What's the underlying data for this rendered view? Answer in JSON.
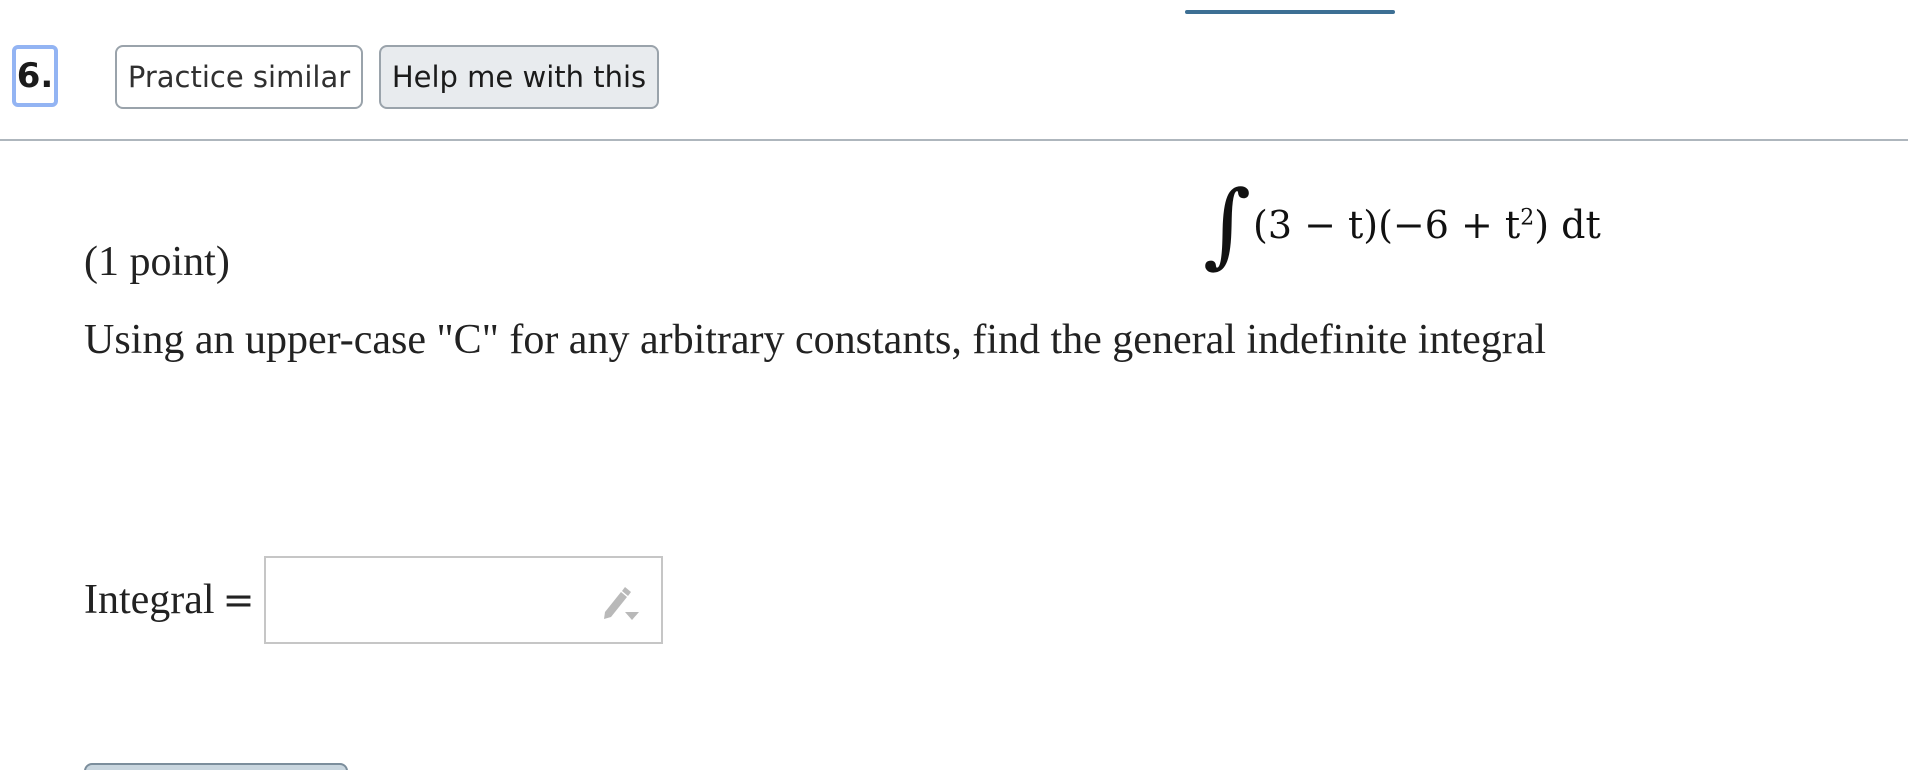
{
  "question": {
    "number": "6.",
    "practice_label": "Practice similar",
    "help_label": "Help me with this"
  },
  "problem": {
    "points": "(1 point)",
    "prompt": "Using an upper-case \"C\" for any arbitrary constants, find the general indefinite integral",
    "integral_sign": "∫",
    "expression_pre": "(3 − t)(−6 + t",
    "exponent": "2",
    "expression_post": ") dt"
  },
  "answer": {
    "label": "Integral",
    "equals": "=",
    "value": "",
    "placeholder": "",
    "editor_icon": "pencil-icon"
  },
  "colors": {
    "question_number_border": "#93b4f3",
    "accent_bar": "#3d6f94",
    "help_button_bg": "#e8ebee"
  }
}
